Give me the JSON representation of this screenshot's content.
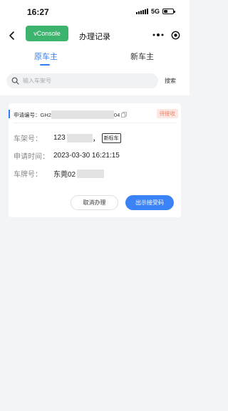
{
  "status_bar": {
    "time": "16:27",
    "network": "5G",
    "icons": [
      "signal-icon",
      "battery-icon"
    ]
  },
  "nav": {
    "title": "办理记录",
    "vconsole_label": "vConsole",
    "icons": [
      "back-icon",
      "more-icon",
      "target-icon"
    ]
  },
  "tabs": [
    {
      "label": "原车主",
      "active": true
    },
    {
      "label": "新车主",
      "active": false
    }
  ],
  "search": {
    "placeholder": "输入车架号",
    "value": "",
    "button_label": "搜索",
    "icon": "search-icon"
  },
  "card": {
    "application_label": "申请编号：",
    "application_prefix": "GH2",
    "application_suffix": "04",
    "status": "待接收",
    "rows": [
      {
        "label": "车架号：",
        "value": "123",
        "value_trail": "，",
        "tag": "新标车"
      },
      {
        "label": "申请时间：",
        "value": "2023-03-30 16:21:15"
      },
      {
        "label": "车牌号：",
        "value": "东莞02"
      }
    ],
    "cancel_label": "取消办理",
    "show_code_label": "出示接受码"
  },
  "colors": {
    "accent": "#2f7ef6",
    "vconsole": "#3cb46e",
    "status_badge_bg": "#fde7e2",
    "status_badge_text": "#f0826b",
    "primary_button": "#3b82f6"
  }
}
